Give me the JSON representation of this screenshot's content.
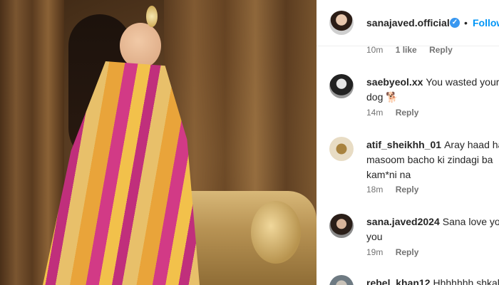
{
  "header": {
    "username": "sanajaved.official",
    "separator": "•",
    "follow_label": "Follow",
    "verified_glyph": "✓"
  },
  "top_meta": {
    "time": "10m",
    "likes": "1 like",
    "reply": "Reply"
  },
  "comments": [
    {
      "username": "saebyeol.xx",
      "text_line1": "You wasted your",
      "text_line2": "dog 🐕",
      "time": "14m",
      "reply": "Reply"
    },
    {
      "username": "atif_sheikhh_01",
      "text_line1": "Aray haad ha",
      "text_line2": "masoom bacho ki zindagi ba",
      "text_line3": "kam*ni na",
      "time": "18m",
      "reply": "Reply"
    },
    {
      "username": "sana.javed2024",
      "text_line1": "Sana love yo",
      "text_line2": "you",
      "time": "19m",
      "reply": "Reply"
    },
    {
      "username": "rebel_khan12",
      "text_line1": "Hhhhhhh shkal"
    }
  ],
  "colors": {
    "accent": "#0095f6",
    "verified": "#3897f0",
    "text": "#262626",
    "muted": "#737373"
  }
}
